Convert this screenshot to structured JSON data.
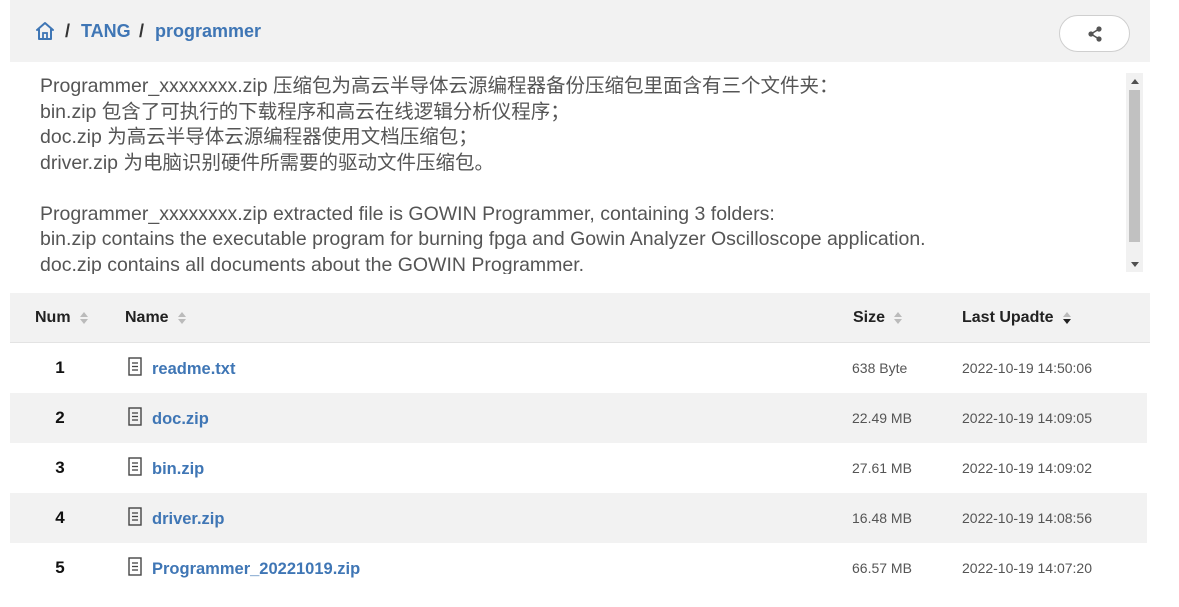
{
  "breadcrumb": {
    "home_icon": "home-icon",
    "separator": "/",
    "items": [
      {
        "label": "TANG"
      },
      {
        "label": "programmer"
      }
    ]
  },
  "share": {
    "icon": "share-icon"
  },
  "description": {
    "text": "Programmer_xxxxxxxx.zip 压缩包为高云半导体云源编程器备份压缩包里面含有三个文件夹：\nbin.zip 包含了可执行的下载程序和高云在线逻辑分析仪程序；\ndoc.zip 为高云半导体云源编程器使用文档压缩包；\ndriver.zip 为电脑识别硬件所需要的驱动文件压缩包。\n\nProgrammer_xxxxxxxx.zip extracted file is GOWIN Programmer, containing 3 folders:\nbin.zip contains the executable program for burning fpga and Gowin Analyzer Oscilloscope application.\ndoc.zip contains all documents about the GOWIN Programmer.\ndriver.zip contains drivers for computer to recognize the device."
  },
  "table": {
    "columns": {
      "num": "Num",
      "name": "Name",
      "size": "Size",
      "last_update": "Last Upadte"
    },
    "sorted_column": "last_update",
    "sort_direction": "descending",
    "rows": [
      {
        "num": "1",
        "name": "readme.txt",
        "size": "638 Byte",
        "date": "2022-10-19 14:50:06"
      },
      {
        "num": "2",
        "name": "doc.zip",
        "size": "22.49 MB",
        "date": "2022-10-19 14:09:05"
      },
      {
        "num": "3",
        "name": "bin.zip",
        "size": "27.61 MB",
        "date": "2022-10-19 14:09:02"
      },
      {
        "num": "4",
        "name": "driver.zip",
        "size": "16.48 MB",
        "date": "2022-10-19 14:08:56"
      },
      {
        "num": "5",
        "name": "Programmer_20221019.zip",
        "size": "66.57 MB",
        "date": "2022-10-19 14:07:20"
      }
    ]
  },
  "colors": {
    "link": "#3f76b5",
    "header_bg": "#f2f2f2",
    "alt_row_bg": "#f2f2f2"
  }
}
